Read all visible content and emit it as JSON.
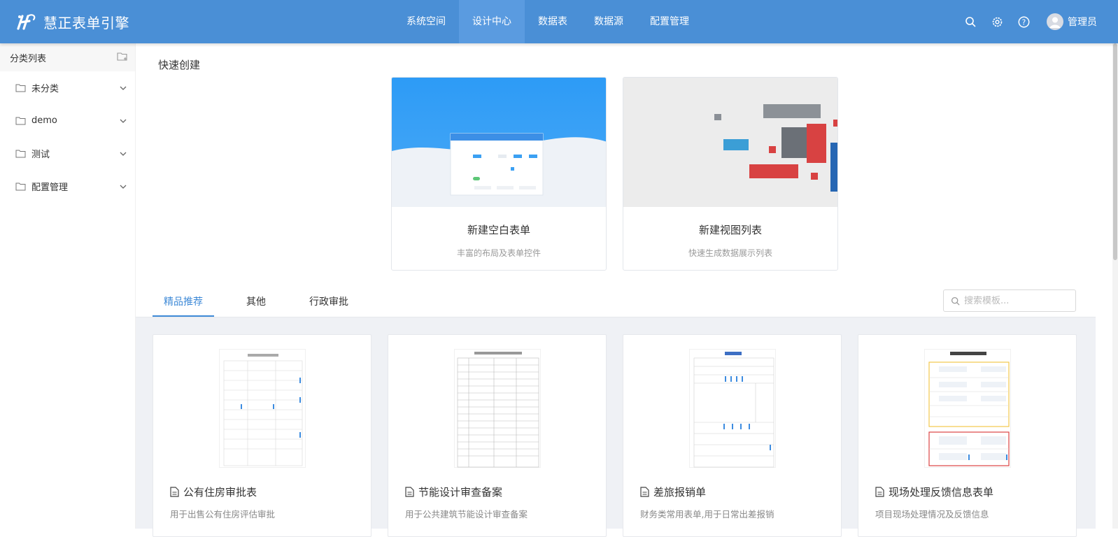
{
  "app": {
    "title": "慧正表单引擎"
  },
  "nav": {
    "items": [
      {
        "label": "系统空间",
        "active": false
      },
      {
        "label": "设计中心",
        "active": true
      },
      {
        "label": "数据表",
        "active": false
      },
      {
        "label": "数据源",
        "active": false
      },
      {
        "label": "配置管理",
        "active": false
      }
    ]
  },
  "header": {
    "user_name": "管理员",
    "icons": [
      "search-icon",
      "gear-icon",
      "help-icon",
      "avatar"
    ]
  },
  "sidebar": {
    "title": "分类列表",
    "items": [
      {
        "label": "未分类"
      },
      {
        "label": "demo"
      },
      {
        "label": "测试"
      },
      {
        "label": "配置管理"
      }
    ]
  },
  "quick_create": {
    "title": "快速创建",
    "cards": [
      {
        "title": "新建空白表单",
        "subtitle": "丰富的布局及表单控件"
      },
      {
        "title": "新建视图列表",
        "subtitle": "快速生成数据展示列表"
      }
    ]
  },
  "tabs": [
    {
      "label": "精品推荐",
      "active": true
    },
    {
      "label": "其他",
      "active": false
    },
    {
      "label": "行政审批",
      "active": false
    }
  ],
  "search": {
    "placeholder": "搜索模板..."
  },
  "templates": [
    {
      "name": "公有住房审批表",
      "desc": "用于出售公有住房评估审批"
    },
    {
      "name": "节能设计审查备案",
      "desc": "用于公共建筑节能设计审查备案"
    },
    {
      "name": "差旅报销单",
      "desc": "财务类常用表单,用于日常出差报销"
    },
    {
      "name": "现场处理反馈信息表单",
      "desc": "项目现场处理情况及反馈信息"
    }
  ],
  "colors": {
    "header": "#4a8fd6",
    "accent": "#3f8ad7",
    "gallery_bg": "#eff1f5"
  }
}
